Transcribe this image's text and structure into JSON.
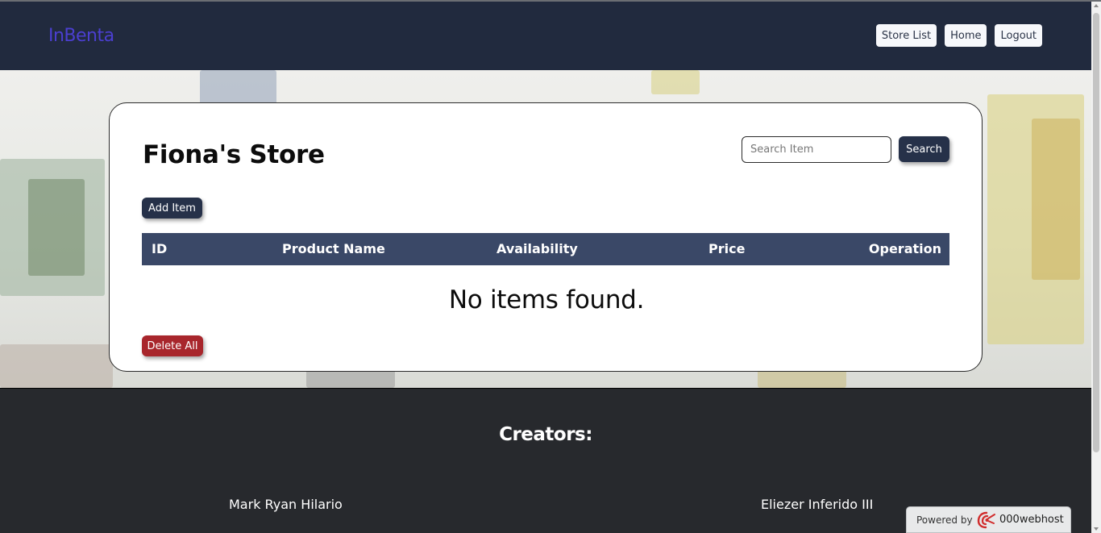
{
  "brand": {
    "name": "InBenta"
  },
  "nav": {
    "items": [
      {
        "label": "Store List"
      },
      {
        "label": "Home"
      },
      {
        "label": "Logout"
      }
    ]
  },
  "store": {
    "title": "Fiona's Store",
    "search": {
      "placeholder": "Search Item",
      "value": "",
      "button_label": "Search"
    },
    "add_label": "Add Item",
    "table": {
      "columns": [
        "ID",
        "Product Name",
        "Availability",
        "Price",
        "Operation"
      ],
      "rows": []
    },
    "empty_message": "No items found.",
    "delete_all_label": "Delete All"
  },
  "footer": {
    "heading": "Creators:",
    "creators": [
      "Mark Ryan Hilario",
      "Eliezer Inferido III"
    ]
  },
  "badge": {
    "powered_by": "Powered by",
    "host": "000webhost"
  },
  "colors": {
    "navbar": "#212a3e",
    "brand": "#4b3fd0",
    "table_header": "#3a4867",
    "button_dark": "#263149",
    "danger": "#a8262c",
    "footer": "#27292d"
  }
}
